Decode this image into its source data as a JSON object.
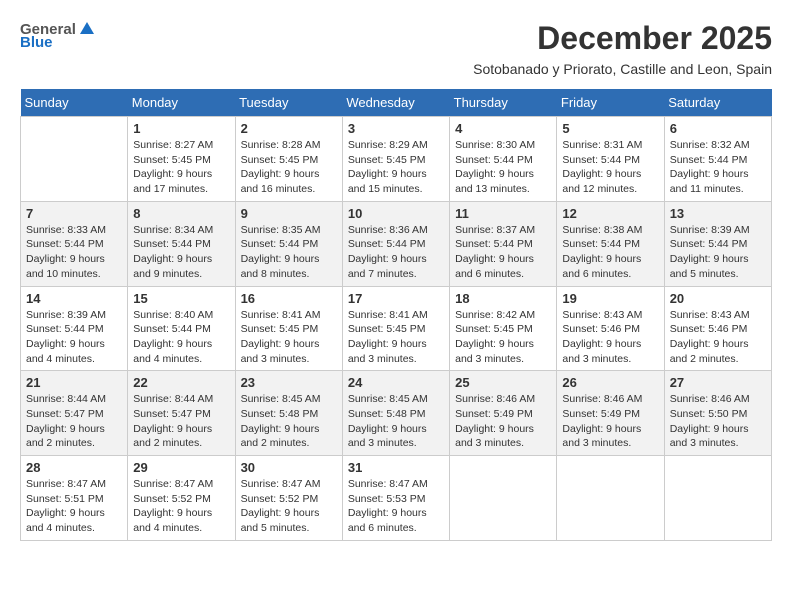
{
  "logo": {
    "general": "General",
    "blue": "Blue"
  },
  "title": "December 2025",
  "subtitle": "Sotobanado y Priorato, Castille and Leon, Spain",
  "days_of_week": [
    "Sunday",
    "Monday",
    "Tuesday",
    "Wednesday",
    "Thursday",
    "Friday",
    "Saturday"
  ],
  "weeks": [
    [
      {
        "day": "",
        "sunrise": "",
        "sunset": "",
        "daylight": ""
      },
      {
        "day": "1",
        "sunrise": "Sunrise: 8:27 AM",
        "sunset": "Sunset: 5:45 PM",
        "daylight": "Daylight: 9 hours and 17 minutes."
      },
      {
        "day": "2",
        "sunrise": "Sunrise: 8:28 AM",
        "sunset": "Sunset: 5:45 PM",
        "daylight": "Daylight: 9 hours and 16 minutes."
      },
      {
        "day": "3",
        "sunrise": "Sunrise: 8:29 AM",
        "sunset": "Sunset: 5:45 PM",
        "daylight": "Daylight: 9 hours and 15 minutes."
      },
      {
        "day": "4",
        "sunrise": "Sunrise: 8:30 AM",
        "sunset": "Sunset: 5:44 PM",
        "daylight": "Daylight: 9 hours and 13 minutes."
      },
      {
        "day": "5",
        "sunrise": "Sunrise: 8:31 AM",
        "sunset": "Sunset: 5:44 PM",
        "daylight": "Daylight: 9 hours and 12 minutes."
      },
      {
        "day": "6",
        "sunrise": "Sunrise: 8:32 AM",
        "sunset": "Sunset: 5:44 PM",
        "daylight": "Daylight: 9 hours and 11 minutes."
      }
    ],
    [
      {
        "day": "7",
        "sunrise": "Sunrise: 8:33 AM",
        "sunset": "Sunset: 5:44 PM",
        "daylight": "Daylight: 9 hours and 10 minutes."
      },
      {
        "day": "8",
        "sunrise": "Sunrise: 8:34 AM",
        "sunset": "Sunset: 5:44 PM",
        "daylight": "Daylight: 9 hours and 9 minutes."
      },
      {
        "day": "9",
        "sunrise": "Sunrise: 8:35 AM",
        "sunset": "Sunset: 5:44 PM",
        "daylight": "Daylight: 9 hours and 8 minutes."
      },
      {
        "day": "10",
        "sunrise": "Sunrise: 8:36 AM",
        "sunset": "Sunset: 5:44 PM",
        "daylight": "Daylight: 9 hours and 7 minutes."
      },
      {
        "day": "11",
        "sunrise": "Sunrise: 8:37 AM",
        "sunset": "Sunset: 5:44 PM",
        "daylight": "Daylight: 9 hours and 6 minutes."
      },
      {
        "day": "12",
        "sunrise": "Sunrise: 8:38 AM",
        "sunset": "Sunset: 5:44 PM",
        "daylight": "Daylight: 9 hours and 6 minutes."
      },
      {
        "day": "13",
        "sunrise": "Sunrise: 8:39 AM",
        "sunset": "Sunset: 5:44 PM",
        "daylight": "Daylight: 9 hours and 5 minutes."
      }
    ],
    [
      {
        "day": "14",
        "sunrise": "Sunrise: 8:39 AM",
        "sunset": "Sunset: 5:44 PM",
        "daylight": "Daylight: 9 hours and 4 minutes."
      },
      {
        "day": "15",
        "sunrise": "Sunrise: 8:40 AM",
        "sunset": "Sunset: 5:44 PM",
        "daylight": "Daylight: 9 hours and 4 minutes."
      },
      {
        "day": "16",
        "sunrise": "Sunrise: 8:41 AM",
        "sunset": "Sunset: 5:45 PM",
        "daylight": "Daylight: 9 hours and 3 minutes."
      },
      {
        "day": "17",
        "sunrise": "Sunrise: 8:41 AM",
        "sunset": "Sunset: 5:45 PM",
        "daylight": "Daylight: 9 hours and 3 minutes."
      },
      {
        "day": "18",
        "sunrise": "Sunrise: 8:42 AM",
        "sunset": "Sunset: 5:45 PM",
        "daylight": "Daylight: 9 hours and 3 minutes."
      },
      {
        "day": "19",
        "sunrise": "Sunrise: 8:43 AM",
        "sunset": "Sunset: 5:46 PM",
        "daylight": "Daylight: 9 hours and 3 minutes."
      },
      {
        "day": "20",
        "sunrise": "Sunrise: 8:43 AM",
        "sunset": "Sunset: 5:46 PM",
        "daylight": "Daylight: 9 hours and 2 minutes."
      }
    ],
    [
      {
        "day": "21",
        "sunrise": "Sunrise: 8:44 AM",
        "sunset": "Sunset: 5:47 PM",
        "daylight": "Daylight: 9 hours and 2 minutes."
      },
      {
        "day": "22",
        "sunrise": "Sunrise: 8:44 AM",
        "sunset": "Sunset: 5:47 PM",
        "daylight": "Daylight: 9 hours and 2 minutes."
      },
      {
        "day": "23",
        "sunrise": "Sunrise: 8:45 AM",
        "sunset": "Sunset: 5:48 PM",
        "daylight": "Daylight: 9 hours and 2 minutes."
      },
      {
        "day": "24",
        "sunrise": "Sunrise: 8:45 AM",
        "sunset": "Sunset: 5:48 PM",
        "daylight": "Daylight: 9 hours and 3 minutes."
      },
      {
        "day": "25",
        "sunrise": "Sunrise: 8:46 AM",
        "sunset": "Sunset: 5:49 PM",
        "daylight": "Daylight: 9 hours and 3 minutes."
      },
      {
        "day": "26",
        "sunrise": "Sunrise: 8:46 AM",
        "sunset": "Sunset: 5:49 PM",
        "daylight": "Daylight: 9 hours and 3 minutes."
      },
      {
        "day": "27",
        "sunrise": "Sunrise: 8:46 AM",
        "sunset": "Sunset: 5:50 PM",
        "daylight": "Daylight: 9 hours and 3 minutes."
      }
    ],
    [
      {
        "day": "28",
        "sunrise": "Sunrise: 8:47 AM",
        "sunset": "Sunset: 5:51 PM",
        "daylight": "Daylight: 9 hours and 4 minutes."
      },
      {
        "day": "29",
        "sunrise": "Sunrise: 8:47 AM",
        "sunset": "Sunset: 5:52 PM",
        "daylight": "Daylight: 9 hours and 4 minutes."
      },
      {
        "day": "30",
        "sunrise": "Sunrise: 8:47 AM",
        "sunset": "Sunset: 5:52 PM",
        "daylight": "Daylight: 9 hours and 5 minutes."
      },
      {
        "day": "31",
        "sunrise": "Sunrise: 8:47 AM",
        "sunset": "Sunset: 5:53 PM",
        "daylight": "Daylight: 9 hours and 6 minutes."
      },
      {
        "day": "",
        "sunrise": "",
        "sunset": "",
        "daylight": ""
      },
      {
        "day": "",
        "sunrise": "",
        "sunset": "",
        "daylight": ""
      },
      {
        "day": "",
        "sunrise": "",
        "sunset": "",
        "daylight": ""
      }
    ]
  ]
}
